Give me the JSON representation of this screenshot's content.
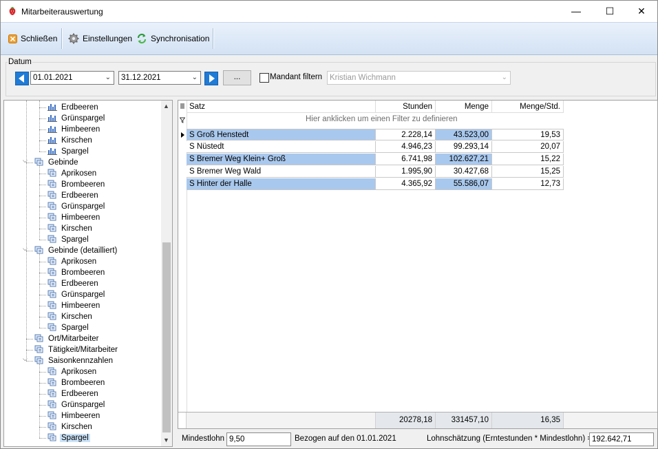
{
  "window": {
    "title": "Mitarbeiterauswertung",
    "controls": {
      "minimize": "—",
      "maximize": "☐",
      "close": "✕"
    }
  },
  "toolbar": {
    "close_label": "Schließen",
    "settings_label": "Einstellungen",
    "sync_label": "Synchronisation"
  },
  "date_filter": {
    "group_label": "Datum",
    "from": "01.01.2021",
    "to": "31.12.2021",
    "more_label": "...",
    "mandant_label": "Mandant filtern",
    "mandant_checked": false,
    "mandant_value": "Kristian Wichmann"
  },
  "tree": {
    "items": [
      {
        "label": "Erdbeeren",
        "level": 2,
        "icon": "chart"
      },
      {
        "label": "Grünspargel",
        "level": 2,
        "icon": "chart"
      },
      {
        "label": "Himbeeren",
        "level": 2,
        "icon": "chart"
      },
      {
        "label": "Kirschen",
        "level": 2,
        "icon": "chart"
      },
      {
        "label": "Spargel",
        "level": 2,
        "icon": "chart"
      },
      {
        "label": "Gebinde",
        "level": 1,
        "icon": "report",
        "expanded": true
      },
      {
        "label": "Aprikosen",
        "level": 2,
        "icon": "report"
      },
      {
        "label": "Brombeeren",
        "level": 2,
        "icon": "report"
      },
      {
        "label": "Erdbeeren",
        "level": 2,
        "icon": "report"
      },
      {
        "label": "Grünspargel",
        "level": 2,
        "icon": "report"
      },
      {
        "label": "Himbeeren",
        "level": 2,
        "icon": "report"
      },
      {
        "label": "Kirschen",
        "level": 2,
        "icon": "report"
      },
      {
        "label": "Spargel",
        "level": 2,
        "icon": "report"
      },
      {
        "label": "Gebinde (detailliert)",
        "level": 1,
        "icon": "report",
        "expanded": true
      },
      {
        "label": "Aprikosen",
        "level": 2,
        "icon": "report"
      },
      {
        "label": "Brombeeren",
        "level": 2,
        "icon": "report"
      },
      {
        "label": "Erdbeeren",
        "level": 2,
        "icon": "report"
      },
      {
        "label": "Grünspargel",
        "level": 2,
        "icon": "report"
      },
      {
        "label": "Himbeeren",
        "level": 2,
        "icon": "report"
      },
      {
        "label": "Kirschen",
        "level": 2,
        "icon": "report"
      },
      {
        "label": "Spargel",
        "level": 2,
        "icon": "report"
      },
      {
        "label": "Ort/Mitarbeiter",
        "level": 1,
        "icon": "report"
      },
      {
        "label": "Tätigkeit/Mitarbeiter",
        "level": 1,
        "icon": "report"
      },
      {
        "label": "Saisonkennzahlen",
        "level": 1,
        "icon": "report",
        "expanded": true
      },
      {
        "label": "Aprikosen",
        "level": 2,
        "icon": "report"
      },
      {
        "label": "Brombeeren",
        "level": 2,
        "icon": "report"
      },
      {
        "label": "Erdbeeren",
        "level": 2,
        "icon": "report"
      },
      {
        "label": "Grünspargel",
        "level": 2,
        "icon": "report"
      },
      {
        "label": "Himbeeren",
        "level": 2,
        "icon": "report"
      },
      {
        "label": "Kirschen",
        "level": 2,
        "icon": "report"
      },
      {
        "label": "Spargel",
        "level": 2,
        "icon": "report",
        "selected": true
      }
    ]
  },
  "grid": {
    "columns": [
      "Satz",
      "Stunden",
      "Menge",
      "Menge/Std."
    ],
    "filter_hint": "Hier anklicken um einen Filter zu definieren",
    "rows": [
      {
        "satz": "S Groß Henstedt",
        "stunden": "2.228,14",
        "menge": "43.523,00",
        "menge_std": "19,53"
      },
      {
        "satz": "S Nüstedt",
        "stunden": "4.946,23",
        "menge": "99.293,14",
        "menge_std": "20,07"
      },
      {
        "satz": "S Bremer Weg Klein+ Groß",
        "stunden": "6.741,98",
        "menge": "102.627,21",
        "menge_std": "15,22"
      },
      {
        "satz": "S Bremer Weg Wald",
        "stunden": "1.995,90",
        "menge": "30.427,68",
        "menge_std": "15,25"
      },
      {
        "satz": "S Hinter der Halle",
        "stunden": "4.365,92",
        "menge": "55.586,07",
        "menge_std": "12,73"
      }
    ],
    "totals": {
      "stunden": "20278,18",
      "menge": "331457,10",
      "menge_std": "16,35"
    }
  },
  "bottom": {
    "mindestlohn_label": "Mindestlohn",
    "mindestlohn_value": "9,50",
    "bezogen_text": "Bezogen auf den 01.01.2021",
    "lohn_label": "Lohnschätzung (Erntestunden * Mindestlohn) =",
    "lohn_value": "192.642,71"
  }
}
